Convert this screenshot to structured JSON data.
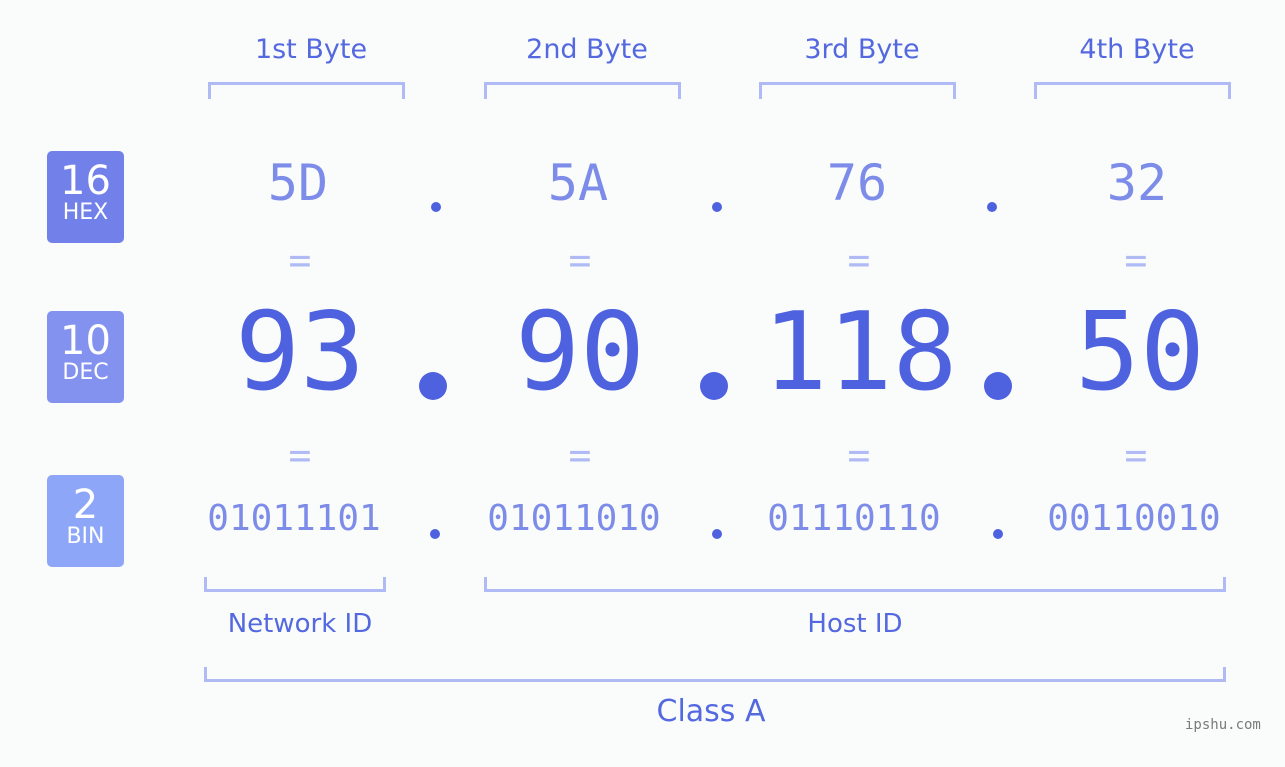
{
  "headers": [
    "1st Byte",
    "2nd Byte",
    "3rd Byte",
    "4th Byte"
  ],
  "badges": {
    "hex": {
      "num": "16",
      "label": "HEX",
      "color": "#7281ea"
    },
    "dec": {
      "num": "10",
      "label": "DEC",
      "color": "#8392ef"
    },
    "bin": {
      "num": "2",
      "label": "BIN",
      "color": "#8ea6f7"
    }
  },
  "hex": [
    "5D",
    "5A",
    "76",
    "32"
  ],
  "dec": [
    "93",
    "90",
    "118",
    "50"
  ],
  "bin": [
    "01011101",
    "01011010",
    "01110110",
    "00110010"
  ],
  "equals_sign": "=",
  "labels": {
    "network": "Network ID",
    "host": "Host ID",
    "class": "Class A"
  },
  "watermark": "ipshu.com"
}
